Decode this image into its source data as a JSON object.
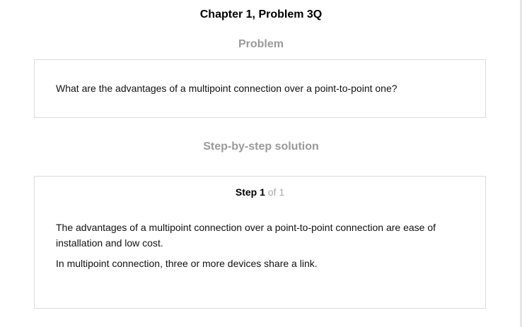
{
  "header": {
    "title": "Chapter 1, Problem 3Q"
  },
  "problem": {
    "heading": "Problem",
    "text": "What are the advantages of a multipoint connection over a point-to-point one?"
  },
  "solution": {
    "heading": "Step-by-step solution",
    "step": {
      "label": "Step 1",
      "of": "of 1",
      "paragraphs": [
        "The advantages of a multipoint connection over a point-to-point connection are ease of installation and low cost.",
        "In multipoint connection, three or more devices share a link."
      ]
    }
  },
  "colors": {
    "heading_gray": "#9a9a9a",
    "border": "#dcdcdc",
    "step_of_gray": "#a8a8a8"
  }
}
